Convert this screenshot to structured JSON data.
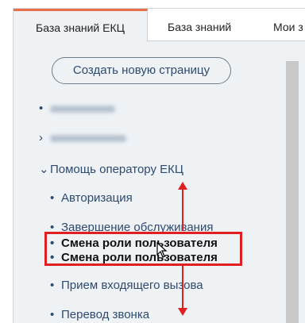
{
  "tabs": [
    {
      "label": "База знаний ЕКЦ",
      "active": true
    },
    {
      "label": "База знаний",
      "active": false
    },
    {
      "label": "Мои з",
      "active": false
    }
  ],
  "create_button": "Создать новую страницу",
  "tree": {
    "section_label": "Помощь оператору ЕКЦ",
    "items": [
      {
        "label": "Авторизация"
      },
      {
        "label": "Завершение обслуживания"
      },
      {
        "label": "Смена роли пользователя"
      },
      {
        "label": "Смена роли пользователя"
      },
      {
        "label": "Прием входящего вызова"
      },
      {
        "label": "Перевод звонка"
      }
    ]
  },
  "colors": {
    "accent": "#e8704e",
    "link": "#2f4a6e",
    "highlight": "#e02020",
    "panel": "#eef2f5"
  }
}
